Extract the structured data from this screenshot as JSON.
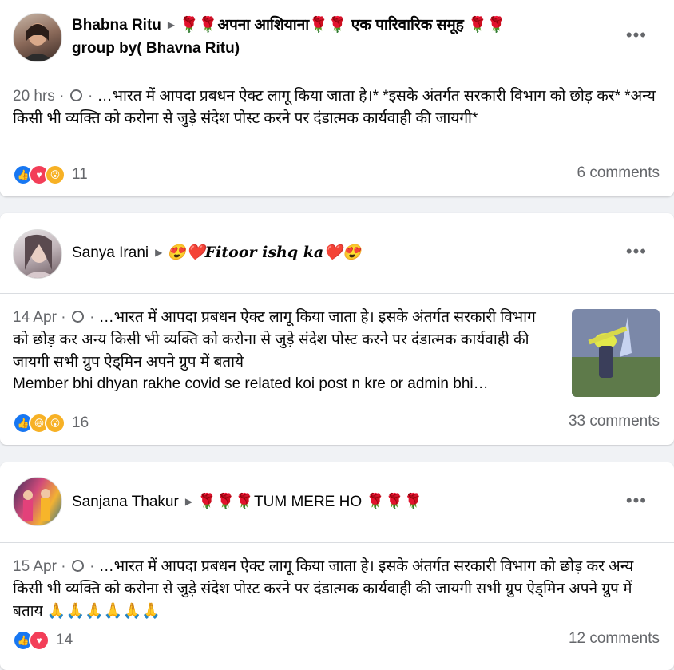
{
  "posts": [
    {
      "author": "Bhabna Ritu",
      "group": "🌹🌹अपना आशियाना🌹🌹 एक पारिवारिक समूह 🌹🌹",
      "group_line2": "group by( Bhavna Ritu)",
      "time": "20 hrs",
      "text": "…भारत में आपदा प्रबधन ऐक्ट लागू किया जाता हे।* *इसके अंतर्गत सरकारी विभाग को छोड़ कर* *अन्य किसी भी व्यक्ति को करोना से जुड़े संदेश पोस्ट करने पर दंडात्मक कार्यवाही की जायगी*",
      "reaction_count": "11",
      "comments": "6 comments"
    },
    {
      "author": "Sanya Irani",
      "group": "😍❤️Fitoor ishq ka❤️😍",
      "time": "14 Apr",
      "text": "…भारत में आपदा प्रबधन ऐक्ट लागू किया जाता हे। इसके अंतर्गत सरकारी विभाग को छोड़ कर अन्य किसी भी व्यक्ति को करोना से जुड़े संदेश पोस्ट करने पर दंडात्मक कार्यवाही की जायगी सभी ग्रुप ऐड्मिन अपने ग्रुप में बताये",
      "text_line4": "Member bhi dhyan rakhe covid se related koi post n kre or admin bhi…",
      "reaction_count": "16",
      "comments": "33 comments"
    },
    {
      "author": "Sanjana Thakur",
      "group": "🌹🌹🌹TUM MERE HO 🌹🌹🌹",
      "time": "15 Apr",
      "text": "…भारत में आपदा प्रबधन ऐक्ट लागू किया जाता हे। इसके अंतर्गत सरकारी विभाग को छोड़ कर अन्य किसी भी व्यक्ति को करोना से जुड़े संदेश पोस्ट करने पर दंडात्मक कार्यवाही की जायगी सभी ग्रुप ऐड्मिन अपने ग्रुप में बताय 🙏🙏🙏🙏🙏🙏",
      "reaction_count": "14",
      "comments": "12 comments"
    }
  ],
  "ui": {
    "more_glyph": "•••",
    "arrow_glyph": "▶",
    "dot": "·"
  },
  "colors": {
    "like": "#1877f2",
    "love": "#f33e58",
    "wow": "#f7b125",
    "meta": "#65676b"
  }
}
